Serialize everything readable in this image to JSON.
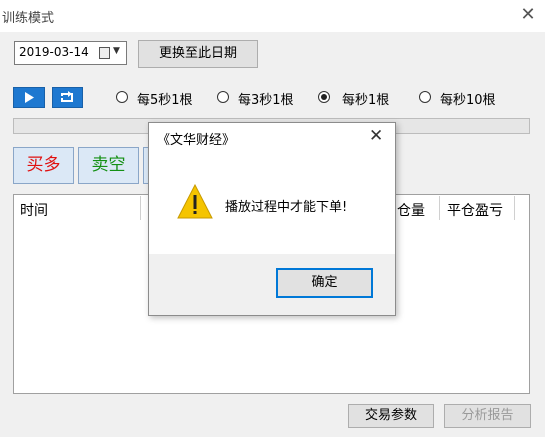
{
  "window": {
    "title": "训练模式",
    "close_glyph": "✕"
  },
  "date": {
    "value": "2019-03-14",
    "change_button": "更换至此日期"
  },
  "speed_options": [
    {
      "label": "每5秒1根",
      "selected": false
    },
    {
      "label": "每3秒1根",
      "selected": false
    },
    {
      "label": "每秒1根",
      "selected": true
    },
    {
      "label": "每秒10根",
      "selected": false
    }
  ],
  "trade": {
    "buy_long": "买多",
    "sell_short": "卖空"
  },
  "table": {
    "headers": [
      "时间",
      "仓量",
      "平仓盈亏"
    ]
  },
  "bottom": {
    "params_button": "交易参数",
    "report_button": "分析报告"
  },
  "dialog": {
    "title": "《文华财经》",
    "close_glyph": "✕",
    "message": "播放过程中才能下单!",
    "ok_button": "确定"
  },
  "colors": {
    "accent": "#1e78d0",
    "buy": "#e01010",
    "sell": "#149014",
    "warning": "#f5c400"
  }
}
